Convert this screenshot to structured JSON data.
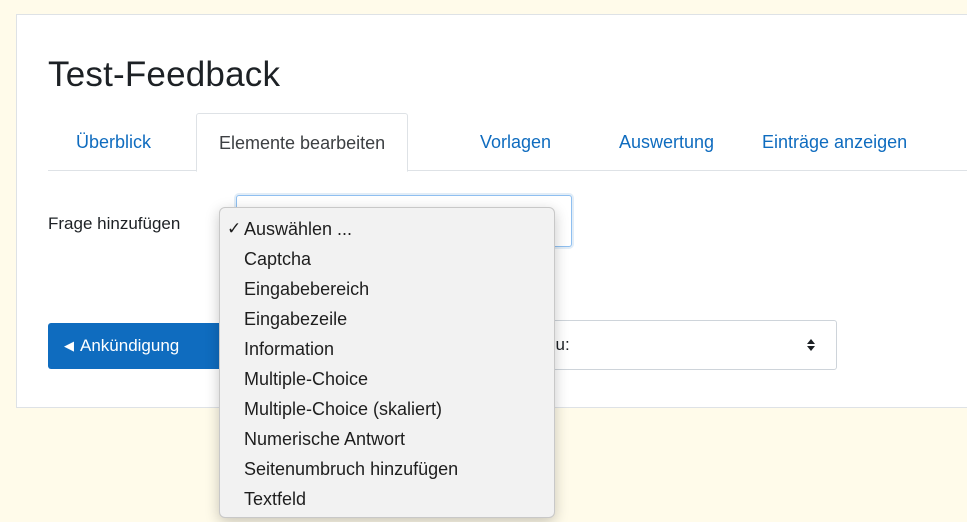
{
  "page": {
    "title": "Test-Feedback"
  },
  "tabs": [
    {
      "label": "Überblick",
      "active": false
    },
    {
      "label": "Elemente bearbeiten",
      "active": true
    },
    {
      "label": "Vorlagen",
      "active": false
    },
    {
      "label": "Auswertung",
      "active": false
    },
    {
      "label": "Einträge anzeigen",
      "active": false
    }
  ],
  "add_question": {
    "label": "Frage hinzufügen",
    "selected": "Auswählen ..."
  },
  "dropdown": {
    "options": [
      "Auswählen ...",
      "Captcha",
      "Eingabebereich",
      "Eingabezeile",
      "Information",
      "Multiple-Choice",
      "Multiple-Choice (skaliert)",
      "Numerische Antwort",
      "Seitenumbruch hinzufügen",
      "Textfeld"
    ],
    "check_icon": "check-icon"
  },
  "navigation": {
    "prev_button_label": "Ankündigung",
    "prev_icon": "left-triangle-icon",
    "jump_select_text": "zu:",
    "jump_icon": "updown-arrows-icon"
  },
  "colors": {
    "accent": "#0f6cbf",
    "background": "#fffbea"
  }
}
